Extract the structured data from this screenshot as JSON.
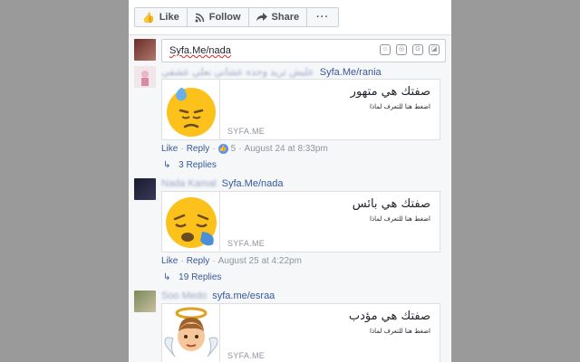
{
  "actions": {
    "like_label": "Like",
    "follow_label": "Follow",
    "share_label": "Share",
    "more_label": "···"
  },
  "composer": {
    "value": "Syfa.Me/nada",
    "icons": [
      "emoji-icon",
      "camera-icon",
      "gif-icon",
      "sticker-icon"
    ]
  },
  "comments": [
    {
      "author_blurred": "عليش تريد وحده عشاني نعلي عشقي",
      "handle": "Syfa.Me/rania",
      "card_title": "صفتك هي متهور",
      "card_sub": "اضغط هنا للتعرف لماذا",
      "domain": "SYFA.ME",
      "emoji": "downcast-sweat-face",
      "like": "Like",
      "reply": "Reply",
      "reactions": "5",
      "time": "August 24 at 8:33pm",
      "replies": "3 Replies"
    },
    {
      "author_blurred": "Nada Kamal",
      "handle": "Syfa.Me/nada",
      "card_title": "صفتك هي بائس",
      "card_sub": "اضغط هنا للتعرف لماذا",
      "domain": "SYFA.ME",
      "emoji": "sleepy-face",
      "like": "Like",
      "reply": "Reply",
      "time": "August 25 at 4:22pm",
      "replies": "19 Replies"
    },
    {
      "author_blurred": "Soo Medo",
      "handle": "syfa.me/esraa",
      "card_title": "صفتك هي مؤدب",
      "card_sub": "اضغط هنا للتعرف لماذا",
      "domain": "SYFA.ME",
      "emoji": "baby-angel"
    }
  ],
  "colors": {
    "link": "#365899",
    "meta": "#90949c",
    "reaction": "#5890ff",
    "emoji_yellow": "#fcc21b"
  }
}
